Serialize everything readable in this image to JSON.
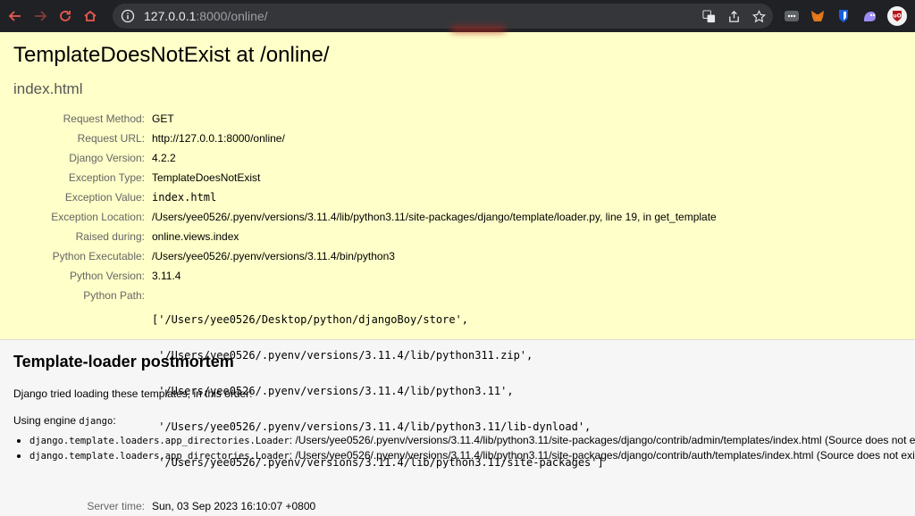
{
  "browser": {
    "url_host": "127.0.0.1",
    "url_path": ":8000/online/"
  },
  "summary": {
    "title": "TemplateDoesNotExist at /online/",
    "subtitle": "index.html",
    "rows": [
      {
        "label": "Request Method:",
        "value": "GET"
      },
      {
        "label": "Request URL:",
        "value": "http://127.0.0.1:8000/online/"
      },
      {
        "label": "Django Version:",
        "value": "4.2.2"
      },
      {
        "label": "Exception Type:",
        "value": "TemplateDoesNotExist"
      },
      {
        "label": "Exception Value:",
        "value": "index.html"
      },
      {
        "label": "Exception Location:",
        "value": "/Users/yee0526/.pyenv/versions/3.11.4/lib/python3.11/site-packages/django/template/loader.py, line 19, in get_template"
      },
      {
        "label": "Raised during:",
        "value": "online.views.index"
      },
      {
        "label": "Python Executable:",
        "value": "/Users/yee0526/.pyenv/versions/3.11.4/bin/python3"
      },
      {
        "label": "Python Version:",
        "value": "3.11.4"
      },
      {
        "label": "Python Path:",
        "lines": [
          "['/Users/yee0526/Desktop/python/djangoBoy/store',",
          " '/Users/yee0526/.pyenv/versions/3.11.4/lib/python311.zip',",
          " '/Users/yee0526/.pyenv/versions/3.11.4/lib/python3.11',",
          " '/Users/yee0526/.pyenv/versions/3.11.4/lib/python3.11/lib-dynload',",
          " '/Users/yee0526/.pyenv/versions/3.11.4/lib/python3.11/site-packages']"
        ]
      },
      {
        "label": "Server time:",
        "value": "Sun, 03 Sep 2023 16:10:07 +0800"
      }
    ]
  },
  "postmortem": {
    "heading": "Template-loader postmortem",
    "intro": "Django tried loading these templates, in this order:",
    "engine_prefix": "Using engine ",
    "engine_name": "django",
    "engine_suffix": ":",
    "loaders": [
      {
        "loader": "django.template.loaders.app_directories.Loader",
        "path": ": /Users/yee0526/.pyenv/versions/3.11.4/lib/python3.11/site-packages/django/contrib/admin/templates/index.html (Source does not exist)"
      },
      {
        "loader": "django.template.loaders.app_directories.Loader",
        "path": ": /Users/yee0526/.pyenv/versions/3.11.4/lib/python3.11/site-packages/django/contrib/auth/templates/index.html (Source does not exist)"
      }
    ]
  },
  "colors": {
    "summary_bg": "#ffffc9",
    "chrome_bg": "#202124"
  }
}
